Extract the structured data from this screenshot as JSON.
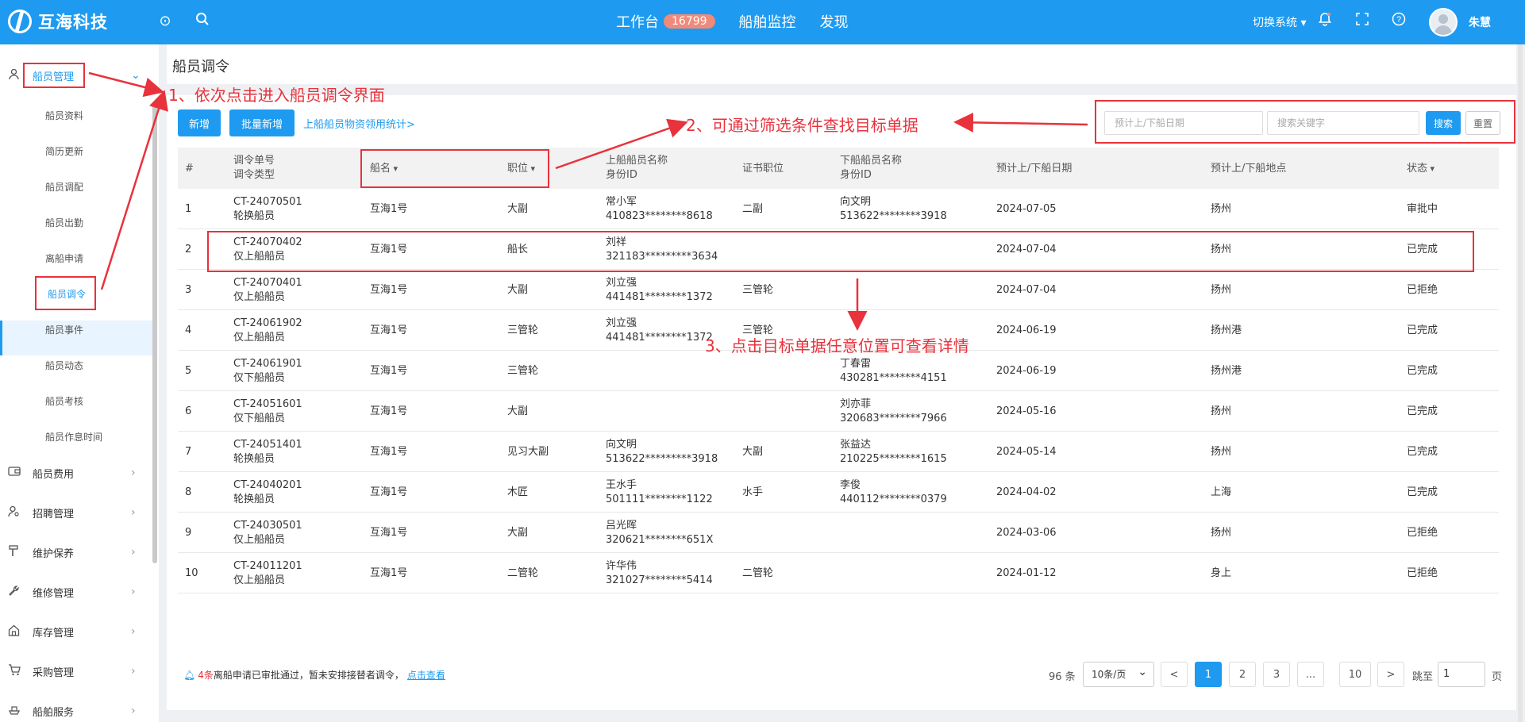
{
  "header": {
    "logo_text": "互海科技",
    "nav": [
      {
        "label": "工作台",
        "badge": "16799"
      },
      {
        "label": "船舶监控"
      },
      {
        "label": "发现"
      }
    ],
    "switch_system": "切换系统",
    "user_name": "朱慧"
  },
  "sidebar": {
    "groups": [
      {
        "label": "船员管理",
        "icon": "user-icon",
        "expanded": true
      },
      {
        "label": "船员费用",
        "icon": "wallet-icon"
      },
      {
        "label": "招聘管理",
        "icon": "person-search-icon"
      },
      {
        "label": "维护保养",
        "icon": "hammer-icon"
      },
      {
        "label": "维修管理",
        "icon": "wrench-icon"
      },
      {
        "label": "库存管理",
        "icon": "home-icon"
      },
      {
        "label": "采购管理",
        "icon": "cart-icon"
      },
      {
        "label": "船舶服务",
        "icon": "ship-icon"
      }
    ],
    "sub_items": [
      "船员资料",
      "简历更新",
      "船员调配",
      "船员出勤",
      "离船申请",
      "船员调令",
      "船员事件",
      "船员动态",
      "船员考核",
      "船员作息时间"
    ],
    "active_sub": "船员调令"
  },
  "page": {
    "title": "船员调令",
    "buttons": {
      "add": "新增",
      "batch_add": "批量新增"
    },
    "stats_link": "上船船员物资领用统计>",
    "filters": {
      "date_placeholder": "预计上/下船日期",
      "keyword_placeholder": "搜索关键字",
      "search": "搜索",
      "reset": "重置"
    }
  },
  "table": {
    "headers": {
      "index": "#",
      "order_no": "调令单号",
      "order_type": "调令类型",
      "ship": "船名",
      "position": "职位",
      "on_name": "上船船员名称",
      "on_id": "身份ID",
      "cert": "证书职位",
      "off_name": "下船船员名称",
      "off_id": "身份ID",
      "date": "预计上/下船日期",
      "place": "预计上/下船地点",
      "status": "状态"
    },
    "rows": [
      {
        "idx": "1",
        "no": "CT-24070501",
        "type": "轮换船员",
        "ship": "互海1号",
        "pos": "大副",
        "on_name": "常小军",
        "on_id": "410823********8618",
        "cert": "二副",
        "off_name": "向文明",
        "off_id": "513622********3918",
        "date": "2024-07-05",
        "place": "扬州",
        "status": "审批中"
      },
      {
        "idx": "2",
        "no": "CT-24070402",
        "type": "仅上船船员",
        "ship": "互海1号",
        "pos": "船长",
        "on_name": "刘祥",
        "on_id": "321183*********3634",
        "cert": "",
        "off_name": "",
        "off_id": "",
        "date": "2024-07-04",
        "place": "扬州",
        "status": "已完成"
      },
      {
        "idx": "3",
        "no": "CT-24070401",
        "type": "仅上船船员",
        "ship": "互海1号",
        "pos": "大副",
        "on_name": "刘立强",
        "on_id": "441481********1372",
        "cert": "三管轮",
        "off_name": "",
        "off_id": "",
        "date": "2024-07-04",
        "place": "扬州",
        "status": "已拒绝"
      },
      {
        "idx": "4",
        "no": "CT-24061902",
        "type": "仅上船船员",
        "ship": "互海1号",
        "pos": "三管轮",
        "on_name": "刘立强",
        "on_id": "441481********1372",
        "cert": "三管轮",
        "off_name": "",
        "off_id": "",
        "date": "2024-06-19",
        "place": "扬州港",
        "status": "已完成"
      },
      {
        "idx": "5",
        "no": "CT-24061901",
        "type": "仅下船船员",
        "ship": "互海1号",
        "pos": "三管轮",
        "on_name": "",
        "on_id": "",
        "cert": "",
        "off_name": "丁春雷",
        "off_id": "430281********4151",
        "date": "2024-06-19",
        "place": "扬州港",
        "status": "已完成"
      },
      {
        "idx": "6",
        "no": "CT-24051601",
        "type": "仅下船船员",
        "ship": "互海1号",
        "pos": "大副",
        "on_name": "",
        "on_id": "",
        "cert": "",
        "off_name": "刘亦菲",
        "off_id": "320683********7966",
        "date": "2024-05-16",
        "place": "扬州",
        "status": "已完成"
      },
      {
        "idx": "7",
        "no": "CT-24051401",
        "type": "轮换船员",
        "ship": "互海1号",
        "pos": "见习大副",
        "on_name": "向文明",
        "on_id": "513622*********3918",
        "cert": "大副",
        "off_name": "张益达",
        "off_id": "210225********1615",
        "date": "2024-05-14",
        "place": "扬州",
        "status": "已完成"
      },
      {
        "idx": "8",
        "no": "CT-24040201",
        "type": "轮换船员",
        "ship": "互海1号",
        "pos": "木匠",
        "on_name": "王水手",
        "on_id": "501111********1122",
        "cert": "水手",
        "off_name": "李俊",
        "off_id": "440112********0379",
        "date": "2024-04-02",
        "place": "上海",
        "status": "已完成"
      },
      {
        "idx": "9",
        "no": "CT-24030501",
        "type": "仅上船船员",
        "ship": "互海1号",
        "pos": "大副",
        "on_name": "吕光晖",
        "on_id": "320621********651X",
        "cert": "",
        "off_name": "",
        "off_id": "",
        "date": "2024-03-06",
        "place": "扬州",
        "status": "已拒绝"
      },
      {
        "idx": "10",
        "no": "CT-24011201",
        "type": "仅上船船员",
        "ship": "互海1号",
        "pos": "二管轮",
        "on_name": "许华伟",
        "on_id": "321027********5414",
        "cert": "二管轮",
        "off_name": "",
        "off_id": "",
        "date": "2024-01-12",
        "place": "身上",
        "status": "已拒绝"
      }
    ]
  },
  "footer": {
    "notice_count": "4条",
    "notice_text": "离船申请已审批通过，暂未安排接替者调令，",
    "notice_link": "点击查看",
    "total": "96 条",
    "page_size": "10条/页",
    "pages": [
      "<",
      "1",
      "2",
      "3",
      "...",
      "10",
      ">"
    ],
    "active_page": "1",
    "jump_label": "跳至",
    "jump_value": "1",
    "page_unit": "页"
  },
  "annotations": {
    "step1": "1、依次点击进入船员调令界面",
    "step2": "2、可通过筛选条件查找目标单据",
    "step3": "3、点击目标单据任意位置可查看详情"
  },
  "colors": {
    "primary": "#1e9bf0",
    "annotation": "#e8323c",
    "badge": "#f08a7a"
  }
}
